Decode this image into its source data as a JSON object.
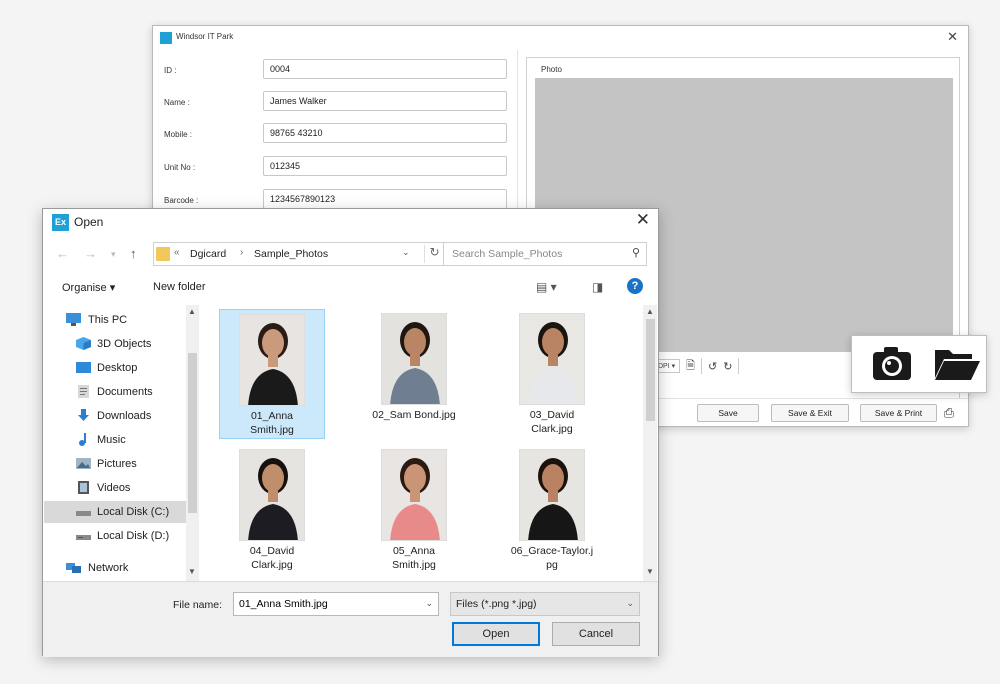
{
  "back_window": {
    "title": "Windsor IT Park",
    "fields": [
      {
        "label": "ID :",
        "value": "0004"
      },
      {
        "label": "Name :",
        "value": "James Walker"
      },
      {
        "label": "Mobile :",
        "value": "98765 43210"
      },
      {
        "label": "Unit No :",
        "value": "012345"
      },
      {
        "label": "Barcode :",
        "value": "1234567890123"
      }
    ],
    "photo_label": "Photo",
    "dpi_label": "DPI",
    "buttons": {
      "save": "Save",
      "save_exit": "Save & Exit",
      "save_print": "Save & Print"
    }
  },
  "open_dialog": {
    "title": "Open",
    "app_icon_text": "Ex",
    "breadcrumb": [
      "Dgicard",
      "Sample_Photos"
    ],
    "search_placeholder": "Search Sample_Photos",
    "toolbar": {
      "organise": "Organise",
      "new_folder": "New folder"
    },
    "nav_items": [
      {
        "label": "This PC",
        "icon": "pc-icon"
      },
      {
        "label": "3D Objects",
        "icon": "cube-icon"
      },
      {
        "label": "Desktop",
        "icon": "desktop-icon"
      },
      {
        "label": "Documents",
        "icon": "documents-icon"
      },
      {
        "label": "Downloads",
        "icon": "download-icon"
      },
      {
        "label": "Music",
        "icon": "music-icon"
      },
      {
        "label": "Pictures",
        "icon": "pictures-icon"
      },
      {
        "label": "Videos",
        "icon": "videos-icon"
      },
      {
        "label": "Local Disk (C:)",
        "icon": "drive-icon",
        "selected": true
      },
      {
        "label": "Local Disk (D:)",
        "icon": "drive-icon"
      },
      {
        "label": "Network",
        "icon": "network-icon"
      }
    ],
    "files": [
      {
        "name": "01_Anna Smith.jpg",
        "line1": "01_Anna",
        "line2": "Smith.jpg",
        "selected": true,
        "shirt": "#1a1a1a",
        "skin": "#c99a7c",
        "hair": "#2a1b14",
        "bg": "#e7e4e1"
      },
      {
        "name": "02_Sam Bond.jpg",
        "line1": "02_Sam Bond.jpg",
        "line2": "",
        "shirt": "#6f7e91",
        "skin": "#b98565",
        "hair": "#1f1712",
        "bg": "#e4e2df"
      },
      {
        "name": "03_David Clark.jpg",
        "line1": "03_David",
        "line2": "Clark.jpg",
        "shirt": "#e6e8ec",
        "skin": "#b98463",
        "hair": "#1b1511",
        "bg": "#e9e7e4"
      },
      {
        "name": "04_David Clark.jpg",
        "line1": "04_David",
        "line2": "Clark.jpg",
        "shirt": "#1c1c22",
        "skin": "#c18e6b",
        "hair": "#16110e",
        "bg": "#e6e4e1"
      },
      {
        "name": "05_Anna Smith.jpg",
        "line1": "05_Anna",
        "line2": "Smith.jpg",
        "shirt": "#e88a8a",
        "skin": "#c99576",
        "hair": "#2b1a12",
        "bg": "#e8e5e2"
      },
      {
        "name": "06_Grace-Taylor.jpg",
        "line1": "06_Grace-Taylor.j",
        "line2": "pg",
        "shirt": "#161616",
        "skin": "#b98262",
        "hair": "#1a120d",
        "bg": "#e7e5e2"
      }
    ],
    "file_name_label": "File name:",
    "file_name_value": "01_Anna Smith.jpg",
    "file_type": "Files (*.png *.jpg)",
    "buttons": {
      "open": "Open",
      "cancel": "Cancel"
    }
  },
  "colors": {
    "accent": "#1fa1d6",
    "selection": "#cce8fb",
    "help": "#1a73c8"
  }
}
